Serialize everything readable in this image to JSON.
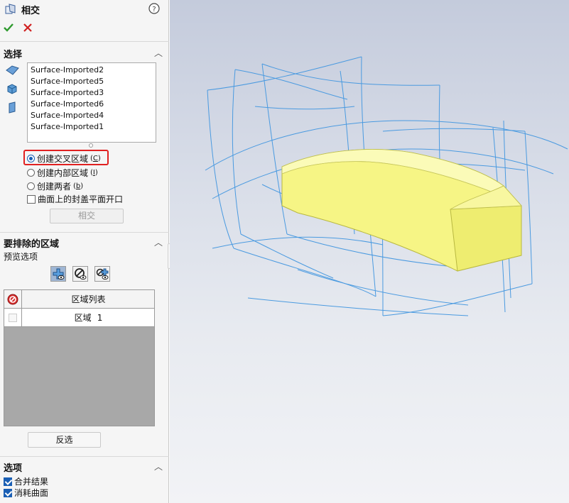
{
  "header": {
    "title": "相交",
    "help_icon": "help-icon",
    "ok_icon": "check-icon",
    "cancel_icon": "close-icon"
  },
  "selection_section": {
    "title": "选择",
    "items": [
      "Surface-Imported2",
      "Surface-Imported5",
      "Surface-Imported3",
      "Surface-Imported6",
      "Surface-Imported4",
      "Surface-Imported1"
    ],
    "options": [
      {
        "label": "创建交叉区域",
        "shortcut": "C",
        "selected": true
      },
      {
        "label": "创建内部区域",
        "shortcut": "I",
        "selected": false
      },
      {
        "label": "创建两者",
        "shortcut": "b",
        "selected": false
      }
    ],
    "cap_checkbox_label": "曲面上的封盖平面开口",
    "cap_checked": false,
    "intersect_button": "相交"
  },
  "exclude_section": {
    "title": "要排除的区域",
    "preview_label": "预览选项",
    "table_header": "区域列表",
    "rows": [
      {
        "name": "区域",
        "index": "1"
      }
    ],
    "invert_button": "反选"
  },
  "options_section": {
    "title": "选项",
    "merge_label": "合并结果",
    "merge_checked": true,
    "consume_label": "消耗曲面",
    "consume_checked": true
  },
  "colors": {
    "accent": "#1a5fb4",
    "highlight_box": "#e02020",
    "wire": "#4a9ae0",
    "solid": "#f6f585"
  }
}
